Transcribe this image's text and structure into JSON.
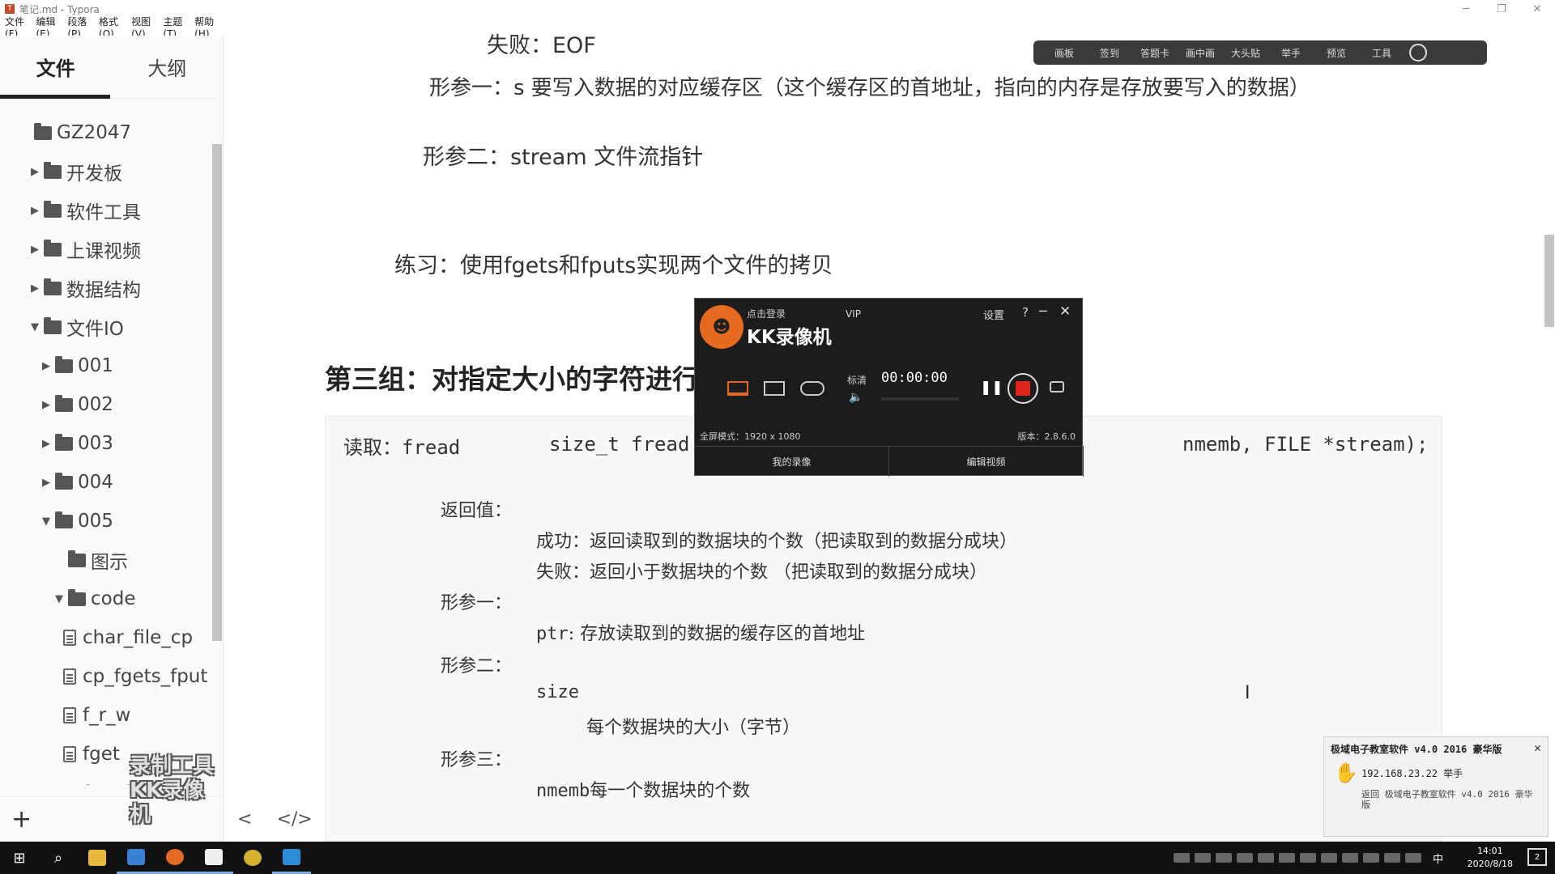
{
  "window": {
    "title": "笔记.md - Typora",
    "controls": [
      "─",
      "❐",
      "✕"
    ]
  },
  "menu": [
    "文件(F)",
    "编辑(E)",
    "段落(P)",
    "格式(O)",
    "视图(V)",
    "主题(T)",
    "帮助(H)"
  ],
  "sidebar": {
    "tabs": [
      "文件",
      "大纲"
    ],
    "tree": [
      {
        "label": "GZ2047",
        "type": "folder",
        "caret": "",
        "indent": 0
      },
      {
        "label": "开发板",
        "type": "folder",
        "caret": "▶",
        "indent": 1
      },
      {
        "label": "软件工具",
        "type": "folder",
        "caret": "▶",
        "indent": 1
      },
      {
        "label": "上课视频",
        "type": "folder",
        "caret": "▶",
        "indent": 1
      },
      {
        "label": "数据结构",
        "type": "folder",
        "caret": "▶",
        "indent": 1
      },
      {
        "label": "文件IO",
        "type": "folder",
        "caret": "▼",
        "indent": 1
      },
      {
        "label": "001",
        "type": "folder",
        "caret": "▶",
        "indent": 2
      },
      {
        "label": "002",
        "type": "folder",
        "caret": "▶",
        "indent": 2
      },
      {
        "label": "003",
        "type": "folder",
        "caret": "▶",
        "indent": 2
      },
      {
        "label": "004",
        "type": "folder",
        "caret": "▶",
        "indent": 2
      },
      {
        "label": "005",
        "type": "folder",
        "caret": "▼",
        "indent": 2
      },
      {
        "label": "图示",
        "type": "folder",
        "caret": "",
        "indent": 3
      },
      {
        "label": "code",
        "type": "folder",
        "caret": "▼",
        "indent": 3
      },
      {
        "label": "char_file_cp",
        "type": "file",
        "caret": "",
        "indent": 4
      },
      {
        "label": "cp_fgets_fput",
        "type": "file",
        "caret": "",
        "indent": 4
      },
      {
        "label": "f_r_w",
        "type": "file",
        "caret": "",
        "indent": 4
      },
      {
        "label": "fget",
        "type": "file",
        "caret": "",
        "indent": 4
      },
      {
        "label": "fread",
        "type": "file",
        "caret": "",
        "indent": 4
      }
    ],
    "add_label": "+",
    "watermark_line1": "录制工具",
    "watermark_line2": "KK录像机"
  },
  "editor": {
    "fail_line": "失败：EOF",
    "param1_line": "形参一：s    要写入数据的对应缓存区（这个缓存区的首地址，指向的内存是存放要写入的数据）",
    "param2_line": "形参二：stream   文件流指针",
    "exercise_line": "练习：使用fgets和fputs实现两个文件的拷贝",
    "heading": "第三组：对指定大小的字符进行",
    "code": {
      "read_label": "读取：",
      "read_fn": "fread",
      "sig_left": "size_t fread",
      "sig_right": "nmemb, FILE *stream);",
      "ret_label": "返回值：",
      "success_line": "成功：返回读取到的数据块的个数（把读取到的数据分成块）",
      "fail_line": "失败：返回小于数据块的个数    （把读取到的数据分成块）",
      "p1_label": "形参一：",
      "p1_name": "ptr",
      "p1_desc": ": 存放读取到的数据的缓存区的首地址",
      "p2_label": "形参二：",
      "p2_name": "size",
      "p2_desc": "每个数据块的大小（字节）",
      "p3_label": "形参三：",
      "p3_name": "nmemb",
      "p3_desc": "每一个数据块的个数"
    },
    "footer_back": "<",
    "footer_source": "</>"
  },
  "float_toolbar": [
    "画板",
    "签到",
    "答题卡",
    "画中画",
    "大头贴",
    "举手",
    "预览",
    "工具"
  ],
  "kk_recorder": {
    "login": "点击登录",
    "vip": "VIP",
    "brand": "KK录像机",
    "settings": "设置",
    "help": "?",
    "minimize": "─",
    "close": "✕",
    "quality": "标清",
    "timer": "00:00:00",
    "mode": "全屏模式：1920 x 1080",
    "version": "版本：2.8.6.0",
    "btn_my_recordings": "我的录像",
    "btn_edit_video": "编辑视频"
  },
  "notification": {
    "title": "极域电子教室软件 v4.0 2016 豪华版",
    "close": "✕",
    "ip_line": "192.168.23.22 举手",
    "message": "返回 极域电子教室软件 v4.0 2016 豪华版"
  },
  "taskbar": {
    "ime": "中",
    "time": "14:01",
    "date": "2020/8/18",
    "notify_count": "2"
  },
  "colors": {
    "accent_orange": "#e56a1f",
    "record_red": "#e0221b",
    "taskbar_bg": "#111111"
  }
}
